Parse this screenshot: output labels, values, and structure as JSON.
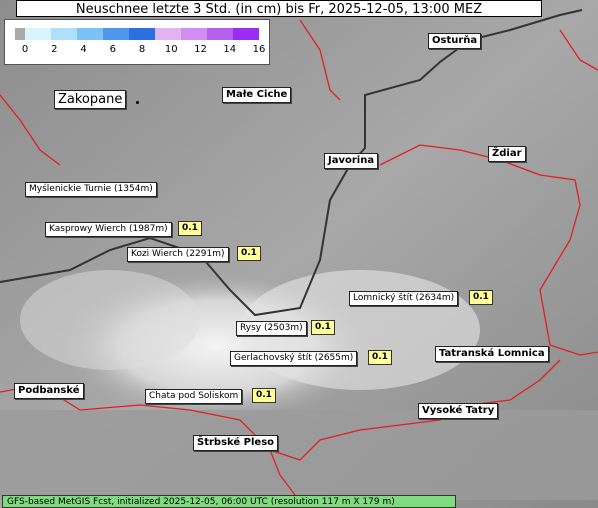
{
  "title": "Neuschnee letzte 3 Std. (in cm) bis Fr, 2025-12-05, 13:00 MEZ",
  "legend": {
    "ticks": [
      "0",
      "2",
      "4",
      "6",
      "8",
      "10",
      "12",
      "14",
      "16"
    ],
    "colors": [
      "#d8f4ff",
      "#aee0fb",
      "#7cc2f5",
      "#5097ec",
      "#2c6fe0",
      "#e3b5f0",
      "#cf8ef0",
      "#b560ec",
      "#9a2ef0"
    ],
    "zero_color": "#aaaaaa"
  },
  "places": [
    {
      "name": "Zakopane",
      "big": true
    },
    {
      "name": "Małe Ciche"
    },
    {
      "name": "Osturňa"
    },
    {
      "name": "Javorina"
    },
    {
      "name": "Ždiar"
    },
    {
      "name": "Tatranská Lomnica"
    },
    {
      "name": "Podbanské"
    },
    {
      "name": "Vysoké Tatry"
    },
    {
      "name": "Štrbské Pleso"
    }
  ],
  "peaks": [
    {
      "name": "Myślenickie Turnie (1354m)",
      "value": ""
    },
    {
      "name": "Kasprowy Wierch (1987m)",
      "value": "0.1"
    },
    {
      "name": "Kozi Wierch (2291m)",
      "value": "0.1"
    },
    {
      "name": "Lomnický štít (2634m)",
      "value": "0.1"
    },
    {
      "name": "Rysy (2503m)",
      "value": "0.1"
    },
    {
      "name": "Gerlachovský štít (2655m)",
      "value": "0.1"
    },
    {
      "name": "Chata pod Soliskom",
      "value": "0.1"
    }
  ],
  "footer": "GFS-based MetGIS Fcst, initialized 2025-12-05, 06:00 UTC  (resolution 117 m X 179 m)"
}
